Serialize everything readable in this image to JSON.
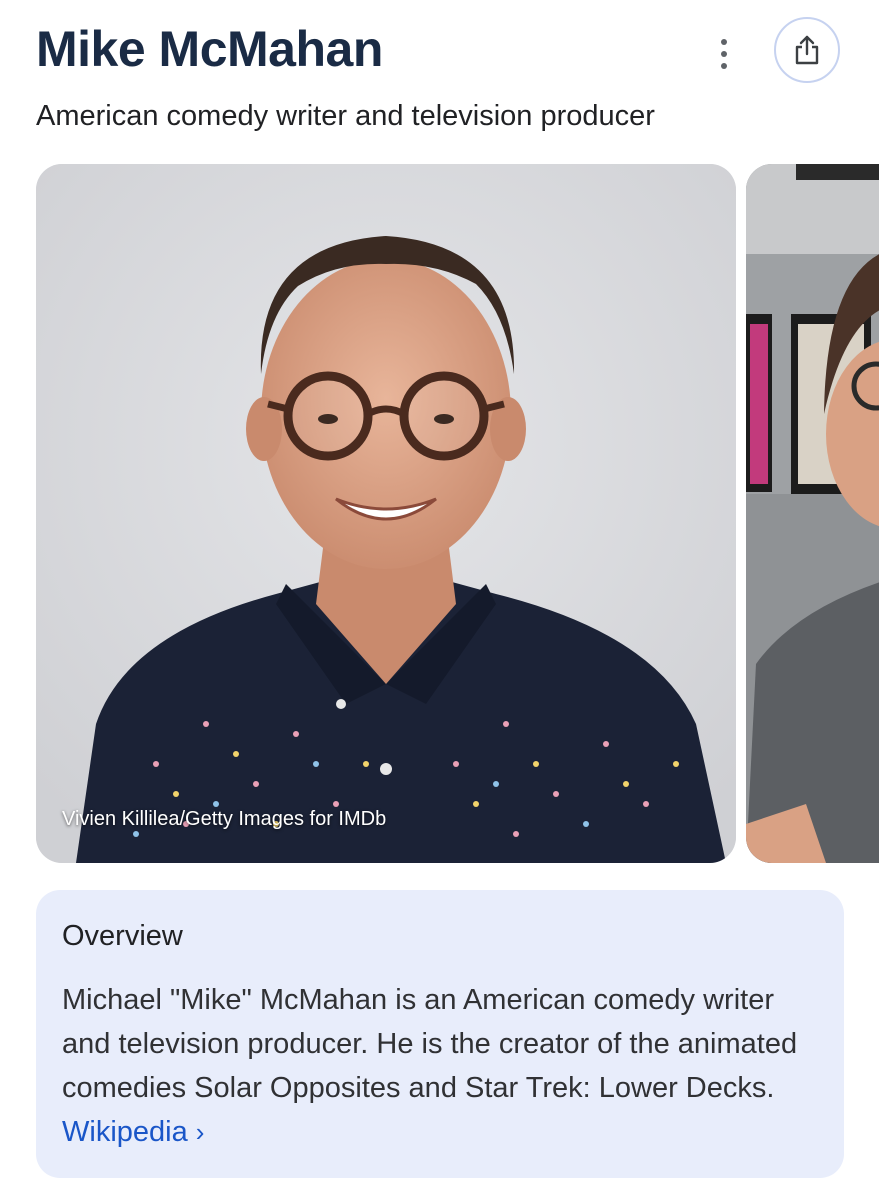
{
  "header": {
    "title": "Mike McMahan",
    "subtitle": "American comedy writer and television producer"
  },
  "actions": {
    "more_icon": "more-vert-icon",
    "share_icon": "share-icon"
  },
  "images": {
    "main_caption": "Vivien Killilea/Getty Images for IMDb"
  },
  "overview": {
    "heading": "Overview",
    "description": "Michael \"Mike\" McMahan is an American comedy writer and television producer. He is the creator of the animated comedies Solar Opposites and Star Trek: Lower Decks.",
    "source_link": "Wikipedia",
    "source_chevron": "›"
  },
  "colors": {
    "title": "#1a2b45",
    "overview_bg": "#e8edfb",
    "link": "#1a56c8",
    "share_border": "#c6d2f0"
  }
}
